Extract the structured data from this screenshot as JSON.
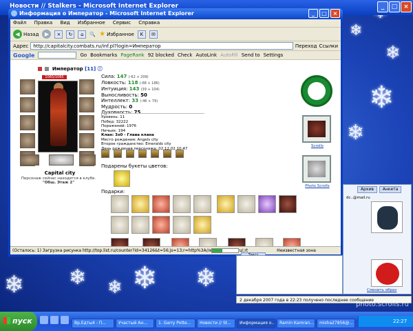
{
  "background_window": {
    "title": "Новости // Stalkers - Microsoft Internet Explorer"
  },
  "ie": {
    "title": "Информация о Император - Microsoft Internet Explorer",
    "menu": [
      "Файл",
      "Правка",
      "Вид",
      "Избранное",
      "Сервис",
      "Справка"
    ],
    "toolbar": {
      "back": "Назад",
      "favorites": "Избранное"
    },
    "address": {
      "label": "Адрес",
      "url": "http://capitalcity.combats.ru/inf.pl?login=Император",
      "go": "Переход",
      "links": "Ссылки"
    },
    "google": {
      "logo": "Google",
      "go": "Go",
      "bookmarks": "Bookmarks",
      "pagerank": "PageRank",
      "blocked": "92 blocked",
      "check": "Check",
      "autolink": "AutoLink",
      "autofill": "AutoFill",
      "send": "Send to",
      "settings": "Settings"
    },
    "status": {
      "text": "(Осталось: 1) Загрузка рисунка http://top.list.ru/counter?id=34126&t=56;js=13;r=http%3A//www.stalkers.ru/;rt",
      "zone": "Неизвестная зона"
    }
  },
  "character": {
    "name": "Император",
    "level": "[11]",
    "hp": "1065/1065",
    "city": "Capital city",
    "city_note_line1": "Персонаж сейчас находится в клубе.",
    "city_note_line2": "\"Обш. Этаж 2\"",
    "stats": [
      {
        "label": "Сила:",
        "value": "147",
        "mod": "(-62 + 209)"
      },
      {
        "label": "Ловкость:",
        "value": "118",
        "mod": "(-68 + 186)"
      },
      {
        "label": "Интуиция:",
        "value": "143",
        "mod": "(39 + 104)"
      },
      {
        "label": "Выносливость:",
        "value": "50",
        "mod": ""
      },
      {
        "label": "Интеллект:",
        "value": "33",
        "mod": "(-46 + 79)"
      },
      {
        "label": "Мудрость:",
        "value": "0",
        "mod": ""
      },
      {
        "label": "Духовность:",
        "value": "75",
        "mod": ""
      }
    ],
    "info": [
      "Уровень: 11",
      "Побед: 32222",
      "Поражений: 1976",
      "Ничьих: 194",
      "Клан: 3x0 - Глава клана",
      "Место рождения: Angels city",
      "Второе гражданство: Emeralds city",
      "День рождения персонажа: 02.12.02 10:47"
    ],
    "bouquet_title": "Подарены букеты цветов:",
    "gifts_title": "Подарки:"
  },
  "sidebar": {
    "scrolls": "Scrolls",
    "photo_scrolls": "Photo Scrolls"
  },
  "messenger": {
    "tabs": [
      "Архив",
      "Анкета"
    ],
    "email": "dc..@mail.ru",
    "avatar_link": "Сменить образ",
    "chat_tab": "Текст",
    "notice": "2 декабря 2007 года в 22:23 получено последнее сообщение"
  },
  "taskbar": {
    "start": "пуск",
    "tasks": [
      "Вр.Едты4 - П...",
      "Участый Ан...",
      "1. Garry Potte...",
      "Новости // St...",
      "Информация о...",
      "Ramin Kamran...",
      "misha27856@..."
    ],
    "time": "22:27"
  },
  "watermark": "photo.scrolls.ru"
}
